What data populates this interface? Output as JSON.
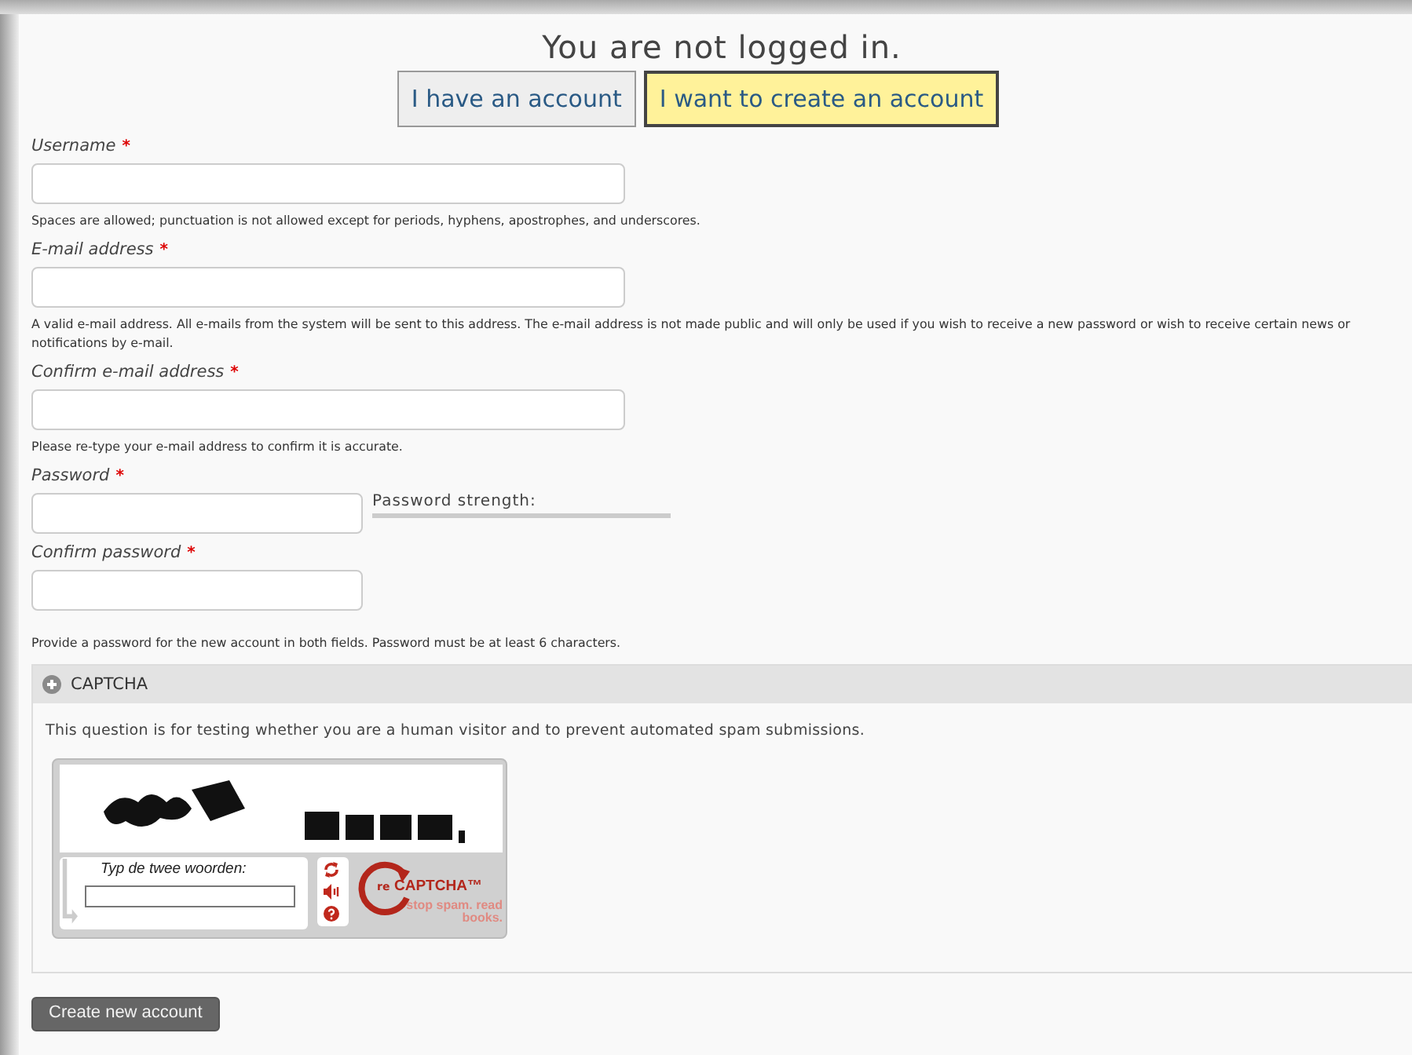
{
  "header": {
    "title": "You are not logged in."
  },
  "tabs": [
    {
      "label": "I have an account",
      "selected": false
    },
    {
      "label": "I want to create an account",
      "selected": true
    }
  ],
  "fields": [
    {
      "label": "Username",
      "required_mark": "*",
      "kind": "text",
      "description": "Spaces are allowed; punctuation is not allowed except for periods, hyphens, apostrophes, and underscores."
    },
    {
      "label": "E-mail address",
      "required_mark": "*",
      "kind": "text",
      "description": "A valid e-mail address. All e-mails from the system will be sent to this address. The e-mail address is not made public and will only be used if you wish to receive a new password or wish to receive certain news or notifications by e-mail."
    },
    {
      "label": "Confirm e-mail address",
      "required_mark": "*",
      "kind": "text",
      "description": "Please re-type your e-mail address to confirm it is accurate."
    },
    {
      "label": "Password",
      "required_mark": "*",
      "kind": "password",
      "strength": {
        "label": "Password strength:",
        "level": 0
      }
    },
    {
      "label": "Confirm password",
      "required_mark": "*",
      "kind": "password",
      "description": "Provide a password for the new account in both fields. Password must be at least 6 characters."
    }
  ],
  "captcha": {
    "legend": "CAPTCHA",
    "description": "This question is for testing whether you are a human visitor and to prevent automated spam submissions.",
    "widget": {
      "prompt": "Typ de twee woorden:",
      "brand": "CAPTCHA™",
      "brand_prefix": "re",
      "tagline": "stop spam. read books."
    }
  },
  "submit": {
    "label": "Create new account"
  }
}
